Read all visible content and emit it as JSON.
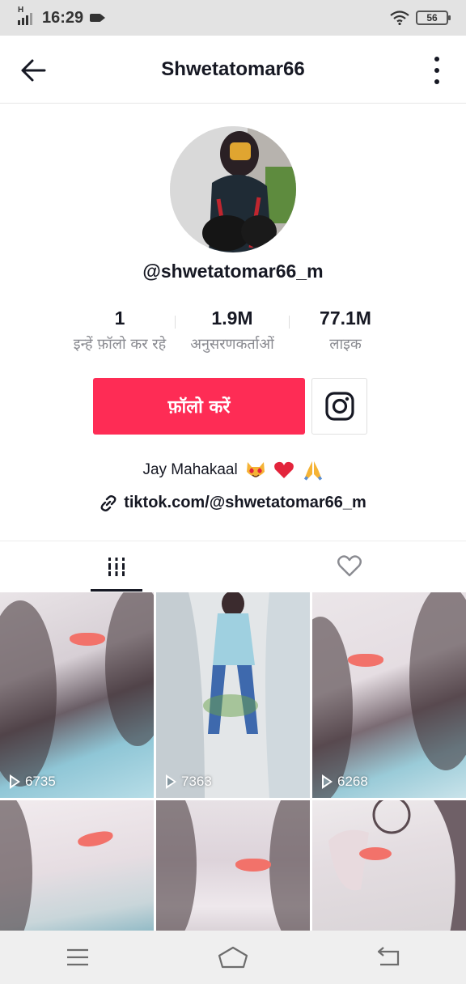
{
  "status_bar": {
    "network": "H",
    "time": "16:29",
    "battery": "56"
  },
  "header": {
    "title": "Shwetatomar66"
  },
  "profile": {
    "username": "@shwetatomar66_m",
    "stats": [
      {
        "value": "1",
        "label": "इन्हें फ़ॉलो कर रहे"
      },
      {
        "value": "1.9M",
        "label": "अनुसरणकर्ताओं"
      },
      {
        "value": "77.1M",
        "label": "लाइक"
      }
    ],
    "follow_label": "फ़ॉलो करें",
    "bio": "Jay Mahakaal",
    "link": "tiktok.com/@shwetatomar66_m"
  },
  "colors": {
    "accent": "#fe2c55",
    "text": "#161823",
    "muted": "#8a8b91"
  },
  "videos": [
    {
      "views": "6735"
    },
    {
      "views": "7363"
    },
    {
      "views": "6268"
    },
    {
      "views": ""
    },
    {
      "views": ""
    },
    {
      "views": ""
    }
  ],
  "icons": {
    "back": "arrow-left-icon",
    "more": "more-vertical-icon",
    "instagram": "instagram-icon",
    "link": "link-icon",
    "grid_tab": "grid-icon",
    "liked_tab": "heart-icon",
    "nav_menu": "menu-icon",
    "nav_home": "home-icon",
    "nav_back": "back-icon"
  }
}
